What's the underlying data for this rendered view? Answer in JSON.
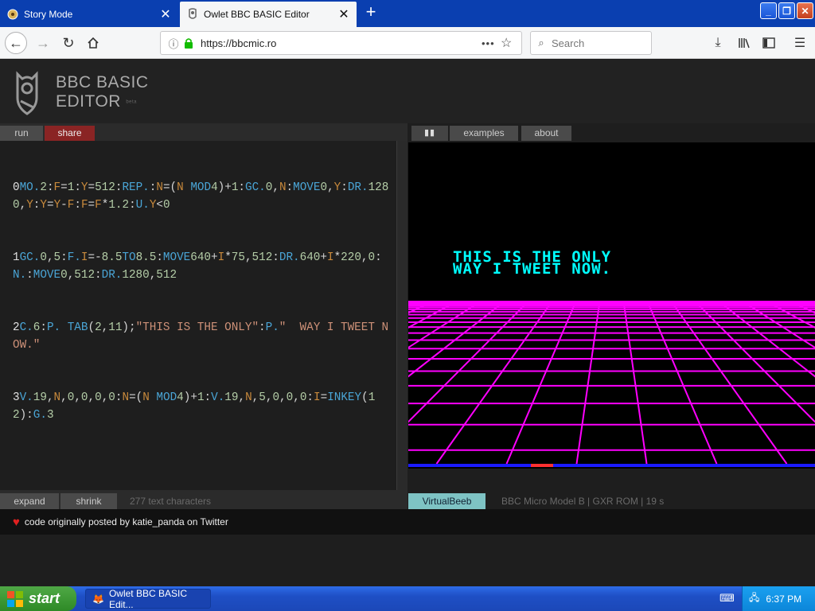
{
  "browser": {
    "tabs": [
      {
        "title": "Story Mode",
        "active": false
      },
      {
        "title": "Owlet BBC BASIC Editor",
        "active": true
      }
    ],
    "url": "https://bbcmic.ro",
    "search_placeholder": "Search"
  },
  "app": {
    "logo_line1": "BBC BASIC",
    "logo_line2": "EDITOR",
    "logo_tag": "beta",
    "left_tabs": {
      "run": "run",
      "share": "share"
    },
    "right_tabs": {
      "pause": "▮▮",
      "examples": "examples",
      "about": "about"
    },
    "status": {
      "expand": "expand",
      "shrink": "shrink",
      "char_count": "277 text characters",
      "emulator": "VirtualBeeb",
      "model": "BBC Micro Model B | GXR ROM | 19 s"
    },
    "credit": "code originally posted by katie_panda on Twitter"
  },
  "code_lines": [
    "0MO.2:F=1:Y=512:REP.:N=(N MOD4)+1:GC.0,N:MOVE0,Y:DR.1280,Y:Y=Y-F:F=F*1.2:U.Y<0",
    "1GC.0,5:F.I=-8.5TO8.5:MOVE640+I*75,512:DR.640+I*220,0:N.:MOVE0,512:DR.1280,512",
    "2C.6:P. TAB(2,11);\"THIS IS THE ONLY\":P.\"  WAY I TWEET NOW.\"",
    "3V.19,N,0,0,0,0:N=(N MOD4)+1:V.19,N,5,0,0,0:I=INKEY(12):G.3"
  ],
  "screen": {
    "line1": "THIS IS THE ONLY",
    "line2": "WAY I TWEET NOW.",
    "text_color": "#00ffff",
    "grid_color": "#ff00ff",
    "bg_color": "#000000"
  },
  "taskbar": {
    "start_label": "start",
    "task_title": "Owlet BBC BASIC Edit...",
    "clock": "6:37 PM"
  }
}
